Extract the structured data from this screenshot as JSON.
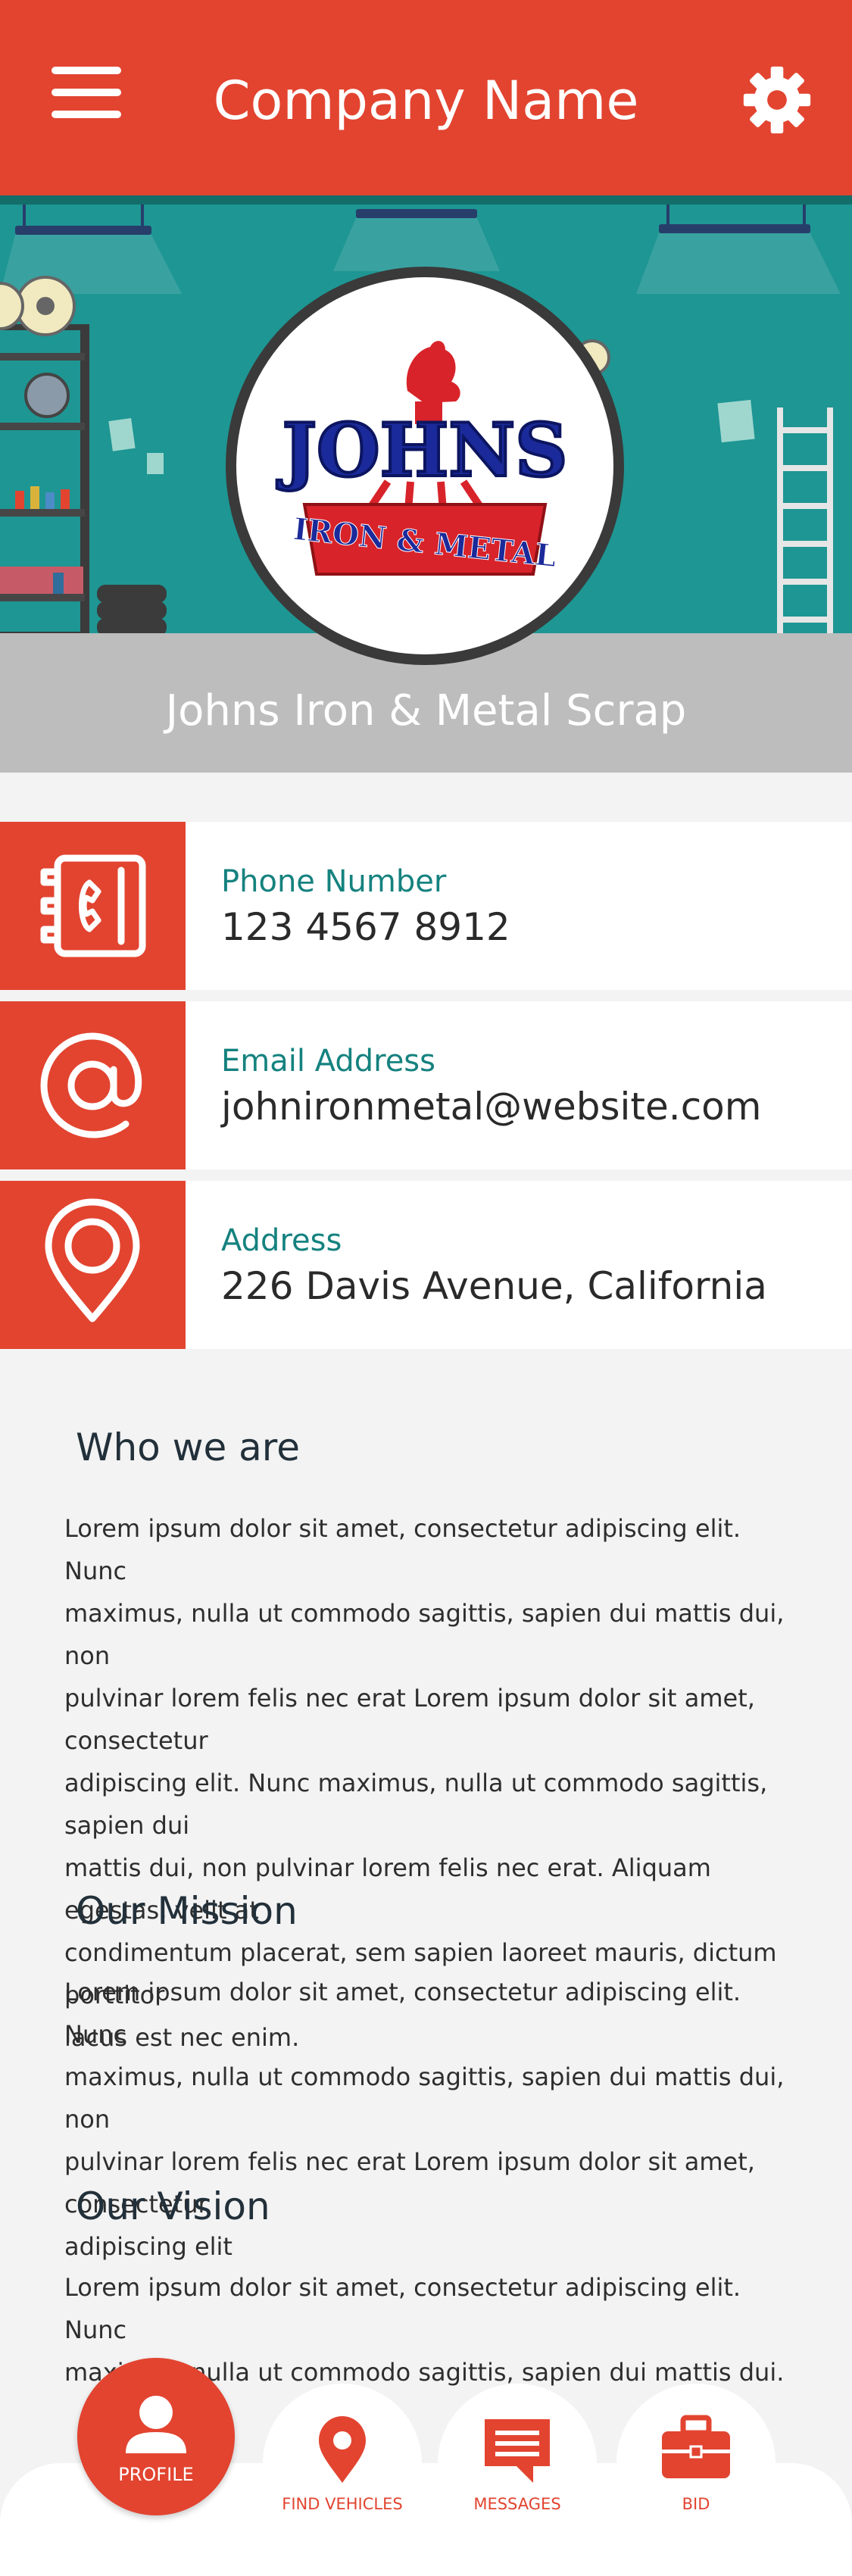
{
  "header": {
    "title": "Company Name",
    "menu_icon": "hamburger-menu-icon",
    "settings_icon": "gear-icon"
  },
  "hero": {
    "company_name": "Johns Iron & Metal Scrap",
    "logo": {
      "wordmark": "JOHNS",
      "tagline": "IRON & METAL"
    }
  },
  "contacts": [
    {
      "icon": "phone-book-icon",
      "label": "Phone Number",
      "value": "123 4567 8912"
    },
    {
      "icon": "at-sign-icon",
      "label": "Email Address",
      "value": "johnironmetal@website.com"
    },
    {
      "icon": "location-pin-icon",
      "label": "Address",
      "value": "226 Davis Avenue, California"
    }
  ],
  "sections": {
    "who": {
      "title": "Who we are",
      "lines": [
        "Lorem ipsum dolor sit amet, consectetur adipiscing elit. Nunc",
        "maximus, nulla ut commodo sagittis, sapien dui mattis dui, non",
        "pulvinar lorem felis nec erat Lorem ipsum dolor sit amet, consectetur",
        "adipiscing elit. Nunc maximus, nulla ut commodo sagittis, sapien dui",
        "mattis dui, non pulvinar lorem felis nec erat. Aliquam egestas, velit at",
        "condimentum placerat, sem sapien laoreet mauris, dictum porttitor",
        "lacus est nec enim."
      ]
    },
    "mission": {
      "title": "Our Mission",
      "lines": [
        "Lorem ipsum dolor sit amet, consectetur adipiscing elit. Nunc",
        "maximus, nulla ut commodo sagittis, sapien dui mattis dui, non",
        "pulvinar lorem felis nec erat Lorem ipsum dolor sit amet, consectetur",
        "adipiscing elit"
      ]
    },
    "vision": {
      "title": "Our Vision",
      "lines": [
        "Lorem ipsum dolor sit amet, consectetur adipiscing elit. Nunc",
        "maximus, nulla ut commodo sagittis, sapien dui mattis dui."
      ]
    }
  },
  "bottom_nav": {
    "items": [
      {
        "label": "PROFILE",
        "icon": "user-icon",
        "active": true
      },
      {
        "label": "FIND VEHICLES",
        "icon": "location-pin-icon",
        "active": false
      },
      {
        "label": "MESSAGES",
        "icon": "chat-bubble-icon",
        "active": false
      },
      {
        "label": "BID",
        "icon": "briefcase-icon",
        "active": false
      }
    ]
  },
  "colors": {
    "primary": "#e24430",
    "teal": "#15827f",
    "hero_bg": "#1e9693"
  }
}
